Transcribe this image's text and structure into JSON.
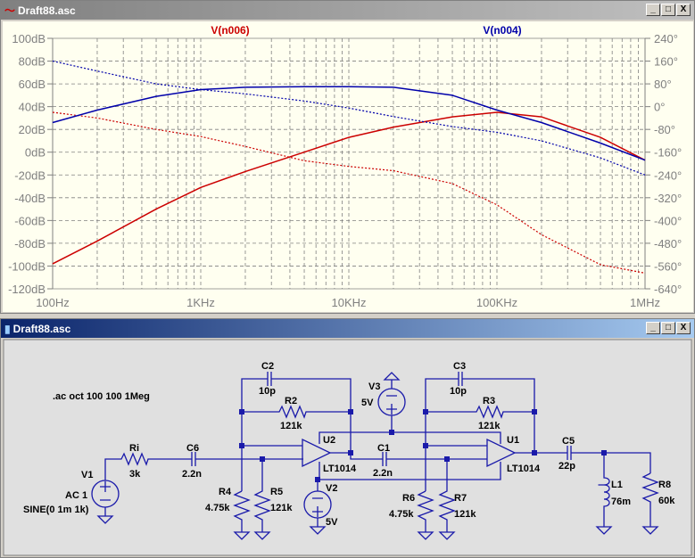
{
  "plot_window": {
    "title": "Draft88.asc",
    "buttons": {
      "minimize": "_",
      "maximize": "□",
      "close": "X"
    }
  },
  "schematic_window": {
    "title": "Draft88.asc",
    "buttons": {
      "minimize": "_",
      "maximize": "□",
      "close": "X"
    }
  },
  "chart_data": {
    "type": "line",
    "xscale": "log",
    "xlim": [
      100,
      1000000
    ],
    "x_ticks": [
      "100Hz",
      "1KHz",
      "10KHz",
      "100KHz",
      "1MHz"
    ],
    "ylim_left": [
      -120,
      100
    ],
    "y_ticks_left": [
      "100dB",
      "80dB",
      "60dB",
      "40dB",
      "20dB",
      "0dB",
      "-20dB",
      "-40dB",
      "-60dB",
      "-80dB",
      "-100dB",
      "-120dB"
    ],
    "ylim_right": [
      -640,
      240
    ],
    "y_ticks_right": [
      "240°",
      "160°",
      "80°",
      "0°",
      "-80°",
      "-160°",
      "-240°",
      "-320°",
      "-400°",
      "-480°",
      "-560°",
      "-640°"
    ],
    "grid": true,
    "x": [
      100,
      200,
      500,
      1000,
      2000,
      5000,
      10000,
      20000,
      50000,
      100000,
      200000,
      500000,
      1000000
    ],
    "series": [
      {
        "name": "V(n006)",
        "color": "#cc0000",
        "magnitude_db": [
          -98,
          -78,
          -50,
          -31,
          -17,
          0,
          13,
          22,
          31,
          35,
          31,
          13,
          -7
        ],
        "phase_deg": [
          -20,
          -40,
          -80,
          -105,
          -140,
          -190,
          -210,
          -225,
          -270,
          -345,
          -450,
          -555,
          -585
        ]
      },
      {
        "name": "V(n004)",
        "color": "#0000aa",
        "magnitude_db": [
          26,
          37,
          49,
          55,
          57,
          57.5,
          57.5,
          57,
          50,
          37,
          26,
          8,
          -7
        ],
        "phase_deg": [
          160,
          125,
          80,
          60,
          45,
          20,
          -5,
          -35,
          -70,
          -90,
          -120,
          -180,
          -240
        ]
      }
    ]
  },
  "schematic": {
    "directive": ".ac oct 100 100 1Meg",
    "labels": {
      "V1": "V1",
      "V1_ac": "AC 1",
      "V1_sine": "SINE(0 1m 1k)",
      "Ri": "Ri",
      "Ri_val": "3k",
      "C6": "C6",
      "C6_val": "2.2n",
      "C2": "C2",
      "C2_val": "10p",
      "R2": "R2",
      "R2_val": "121k",
      "R4": "R4",
      "R4_val": "4.75k",
      "R5": "R5",
      "R5_val": "121k",
      "U2": "U2",
      "U2_val": "LT1014",
      "V2": "V2",
      "V2_val": "5V",
      "V3": "V3",
      "V3_val": "5V",
      "C1": "C1",
      "C1_val": "2.2n",
      "C3": "C3",
      "C3_val": "10p",
      "R3": "R3",
      "R3_val": "121k",
      "R6": "R6",
      "R6_val": "4.75k",
      "R7": "R7",
      "R7_val": "121k",
      "U1": "U1",
      "U1_val": "LT1014",
      "C5": "C5",
      "C5_val": "22p",
      "L1": "L1",
      "L1_val": "76m",
      "R8": "R8",
      "R8_val": "60k"
    }
  }
}
